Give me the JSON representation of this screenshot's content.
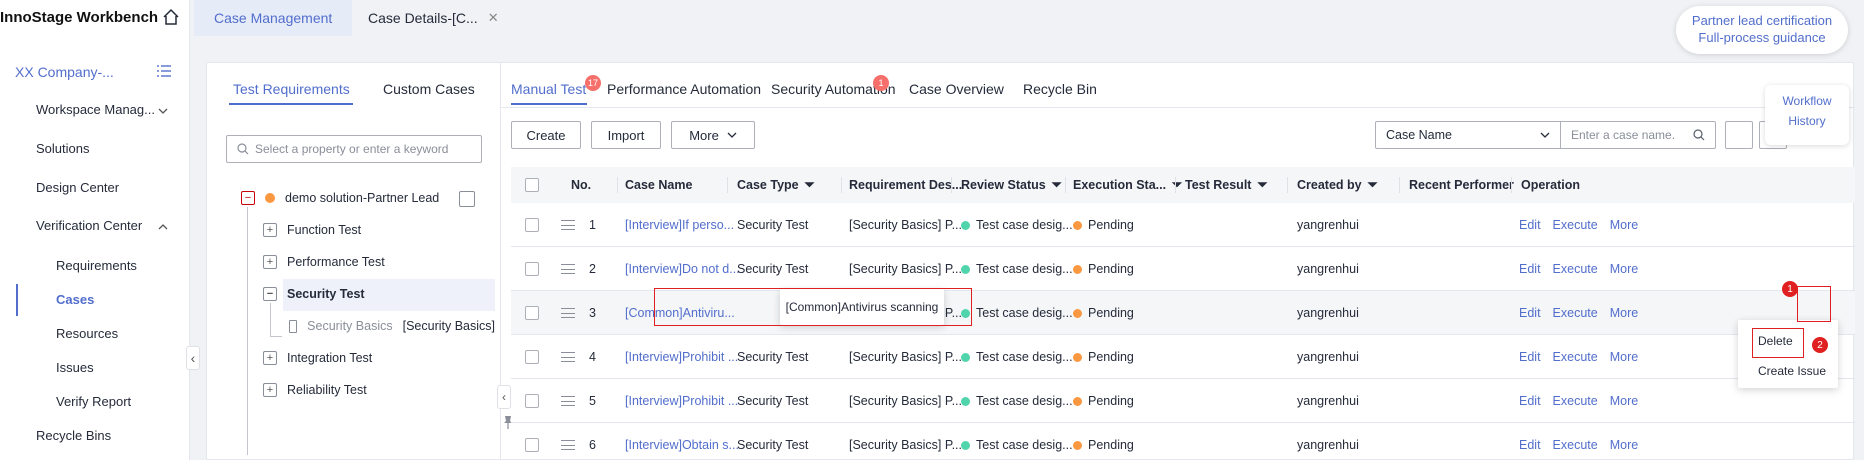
{
  "app": {
    "title": "InnoStage Workbench"
  },
  "sidebar": {
    "company": "XX Company-...",
    "items": [
      {
        "label": "Workspace Manag..."
      },
      {
        "label": "Solutions"
      },
      {
        "label": "Design Center"
      },
      {
        "label": "Verification Center"
      }
    ],
    "sub_items": [
      {
        "label": "Requirements"
      },
      {
        "label": "Cases"
      },
      {
        "label": "Resources"
      },
      {
        "label": "Issues"
      },
      {
        "label": "Verify Report"
      }
    ],
    "recycle": "Recycle Bins"
  },
  "top_tabs": [
    {
      "label": "Case Management"
    },
    {
      "label": "Case Details-[C..."
    }
  ],
  "partner": {
    "line1": "Partner lead certification",
    "line2": "Full-process guidance"
  },
  "tree": {
    "tabs": [
      {
        "label": "Test Requirements"
      },
      {
        "label": "Custom Cases"
      }
    ],
    "search_placeholder": "Select a property or enter a keyword",
    "root": "demo solution-Partner Lead",
    "nodes": [
      {
        "label": "Function Test"
      },
      {
        "label": "Performance Test"
      },
      {
        "label": "Security Test"
      },
      {
        "label": "Integration Test"
      },
      {
        "label": "Reliability Test"
      }
    ],
    "leaf": {
      "name": "Security Basics",
      "desc": "[Security Basics]"
    }
  },
  "content_tabs": [
    {
      "label": "Manual Test",
      "badge": "17"
    },
    {
      "label": "Performance Automation"
    },
    {
      "label": "Security Automation",
      "badge": "1"
    },
    {
      "label": "Case Overview"
    },
    {
      "label": "Recycle Bin"
    }
  ],
  "toolbar": {
    "create": "Create",
    "import": "Import",
    "more": "More",
    "field_select": "Case Name",
    "search_placeholder": "Enter a case name."
  },
  "side_links": {
    "workflow": "Workflow",
    "history": "History"
  },
  "table": {
    "headers": {
      "no": "No.",
      "name": "Case Name",
      "type": "Case Type",
      "req": "Requirement Des...",
      "review": "Review Status",
      "exec": "Execution Sta...",
      "result": "Test Result",
      "created": "Created by",
      "recent": "Recent Performer",
      "operation": "Operation"
    },
    "rows": [
      {
        "no": "1",
        "name": "[Interview]If perso...",
        "type": "Security Test",
        "req": "[Security Basics] P...",
        "review": "Test case desig...",
        "exec": "Pending",
        "created": "yangrenhui"
      },
      {
        "no": "2",
        "name": "[Interview]Do not d...",
        "type": "Security Test",
        "req": "[Security Basics] P...",
        "review": "Test case desig...",
        "exec": "Pending",
        "created": "yangrenhui"
      },
      {
        "no": "3",
        "name": "[Common]Antiviru...",
        "type": "",
        "req": "[Security Basics] P...",
        "review": "Test case desig...",
        "exec": "Pending",
        "created": "yangrenhui"
      },
      {
        "no": "4",
        "name": "[Interview]Prohibit ...",
        "type": "Security Test",
        "req": "[Security Basics] P...",
        "review": "Test case desig...",
        "exec": "Pending",
        "created": "yangrenhui"
      },
      {
        "no": "5",
        "name": "[Interview]Prohibit ...",
        "type": "Security Test",
        "req": "[Security Basics] P...",
        "review": "Test case desig...",
        "exec": "Pending",
        "created": "yangrenhui"
      },
      {
        "no": "6",
        "name": "[Interview]Obtain s...",
        "type": "Security Test",
        "req": "[Security Basics] P...",
        "review": "Test case desig...",
        "exec": "Pending",
        "created": "yangrenhui"
      }
    ],
    "ops": {
      "edit": "Edit",
      "execute": "Execute",
      "more": "More"
    }
  },
  "tooltip": "[Common]Antivirus scanning",
  "dropdown": {
    "delete": "Delete",
    "create_issue": "Create Issue"
  },
  "callouts": {
    "one": "1",
    "two": "2"
  },
  "colors": {
    "accent": "#526ecc",
    "pending": "#fa9841",
    "designed": "#50d4ab",
    "annotation": "#e02020"
  }
}
